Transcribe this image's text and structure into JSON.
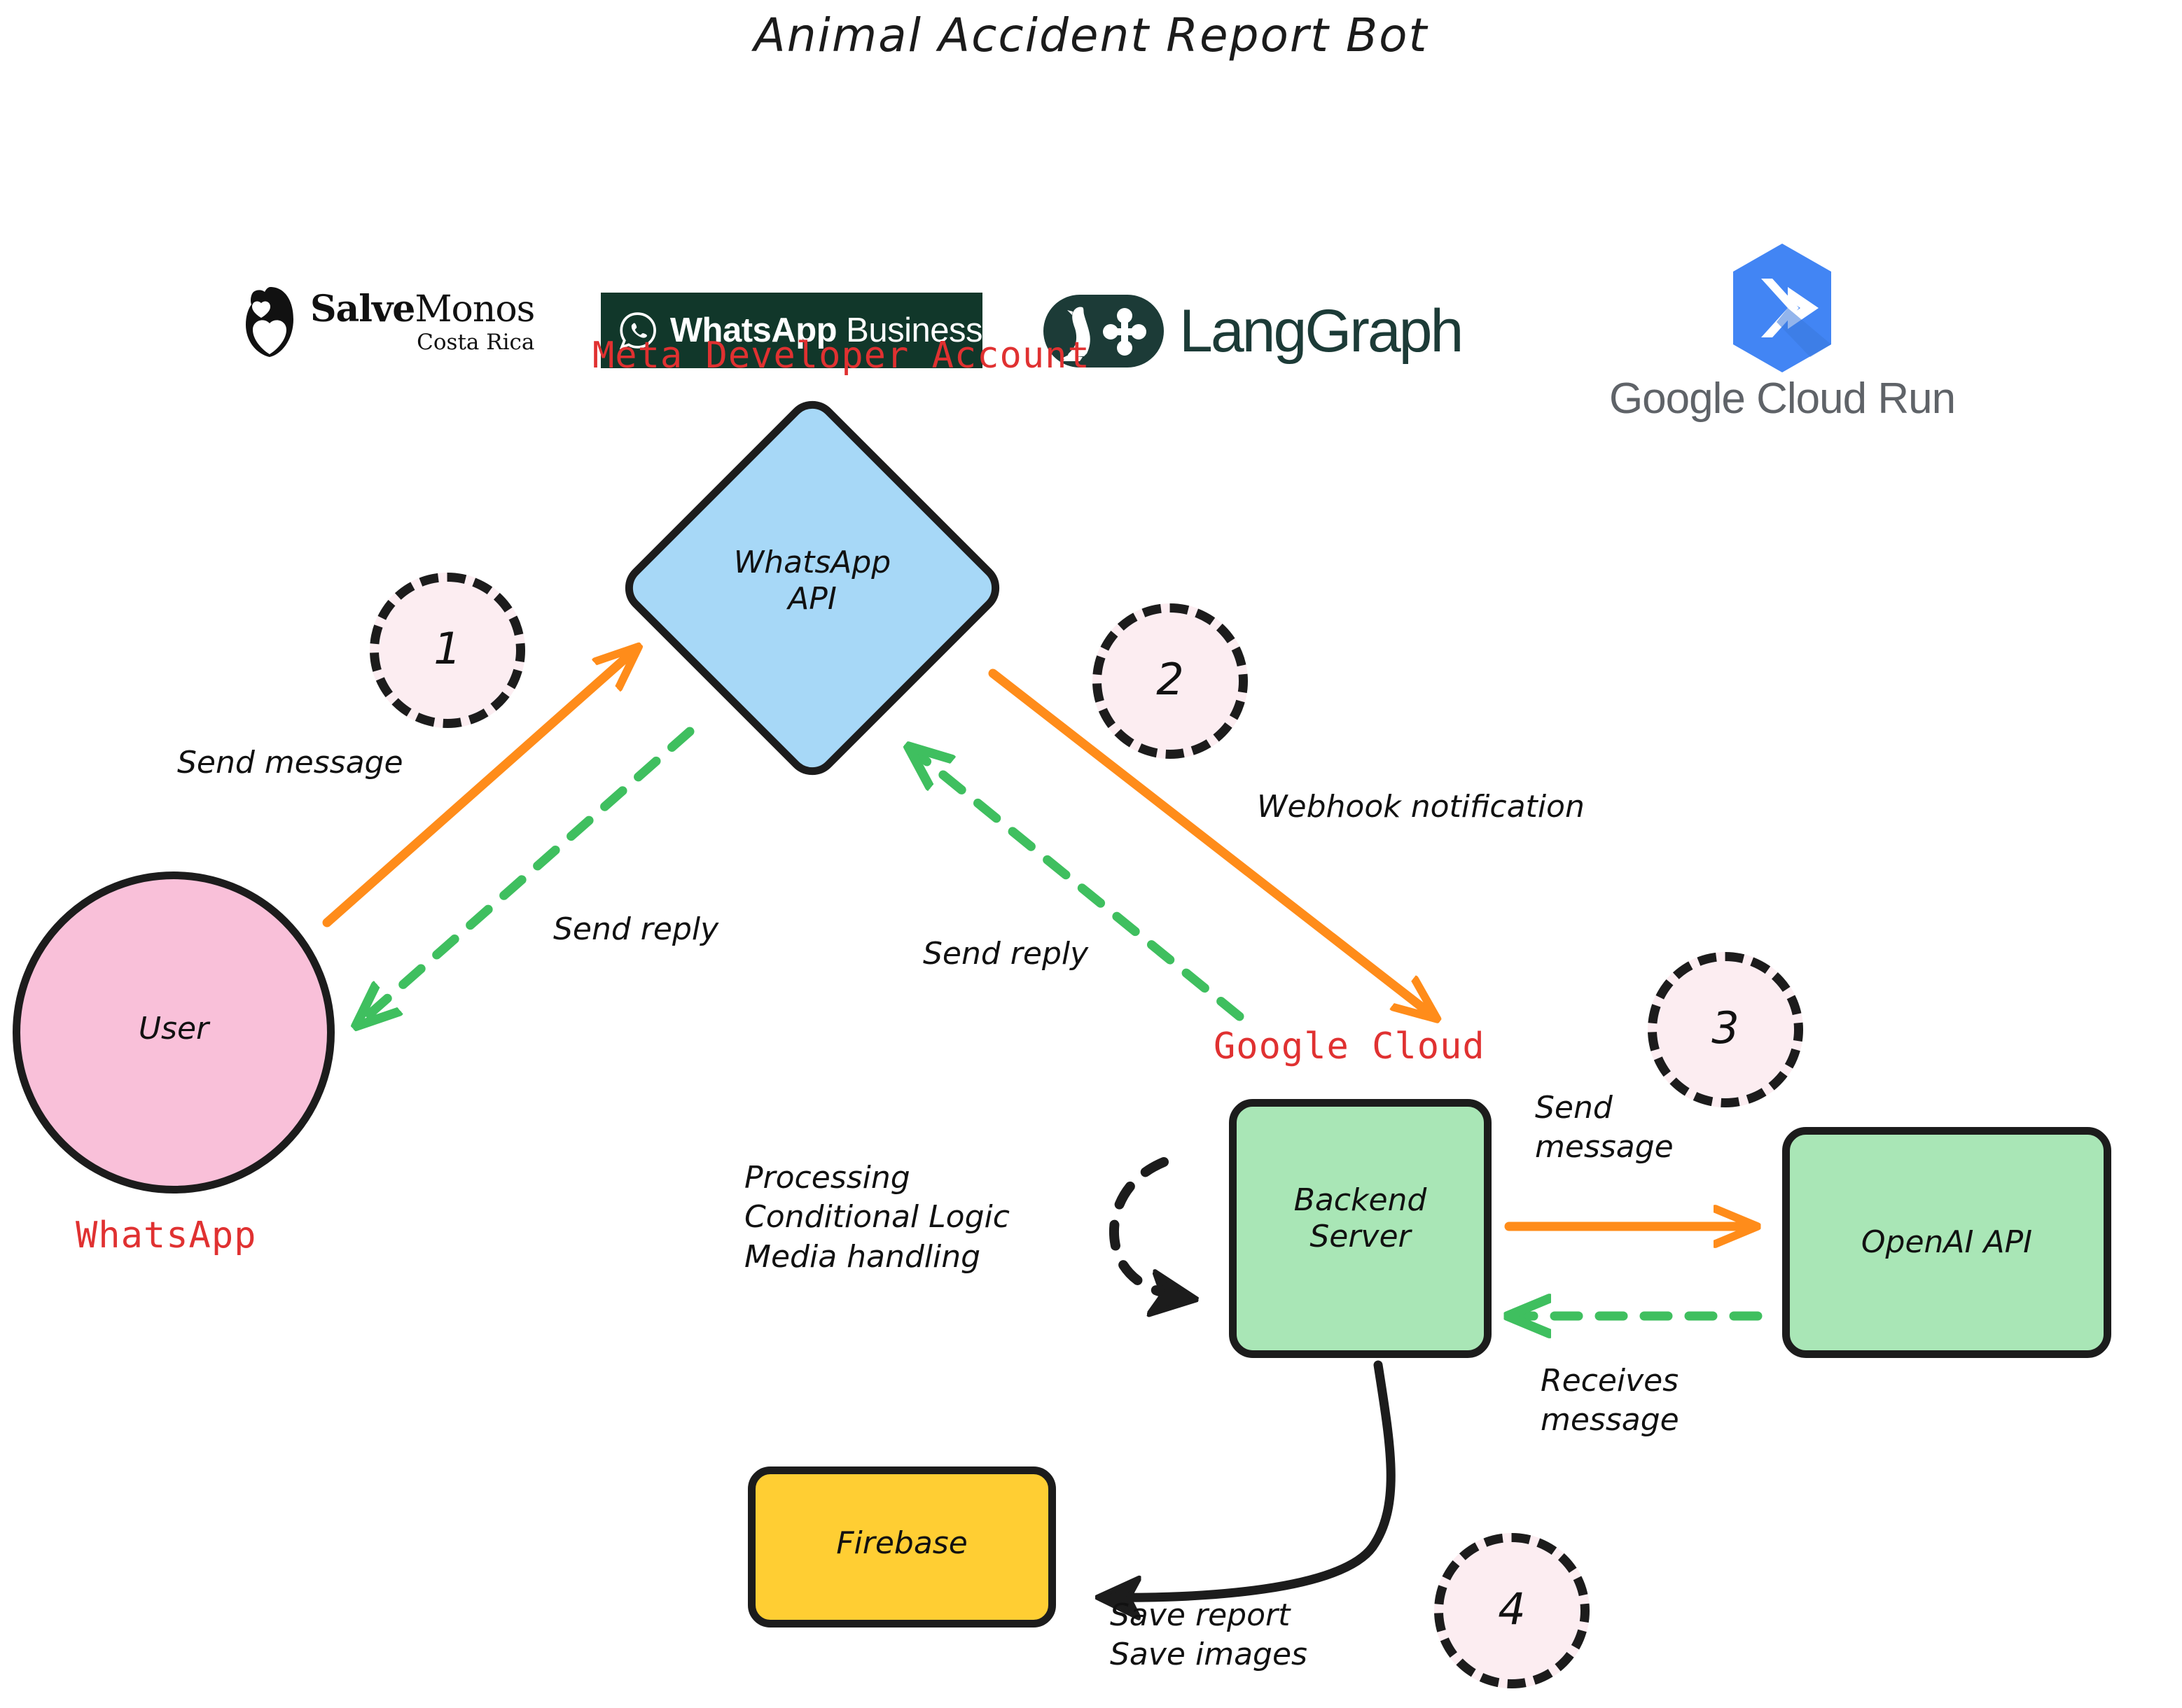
{
  "title": "Animal Accident Report Bot",
  "logos": [
    {
      "name": "salvemonos-logo",
      "primary": "Salve",
      "secondary": "Monos",
      "sub": "Costa Rica",
      "icon": "monkey-head-icon"
    },
    {
      "name": "whatsapp-business-logo",
      "primary": "WhatsApp",
      "secondary": " Business",
      "icon": "whatsapp-phone-icon",
      "bg": "#11372A"
    },
    {
      "name": "langgraph-logo",
      "primary": "LangGraph",
      "icon": "parrot-graph-icon",
      "bg": "#1C3B37"
    },
    {
      "name": "google-cloud-run-logo",
      "primary": "Google",
      "secondary": " Cloud Run",
      "icon": "cloud-run-hexagon-icon",
      "bg": "#4285F4"
    }
  ],
  "group_labels": {
    "meta": "Meta Developer Account",
    "whatsapp": "WhatsApp",
    "google_cloud": "Google Cloud"
  },
  "nodes": {
    "whatsapp_api": {
      "line1": "WhatsApp",
      "line2": "API",
      "color": "#A7D8F7",
      "shape": "diamond"
    },
    "user": {
      "line1": "User",
      "color": "#F9C0D9",
      "shape": "circle"
    },
    "backend": {
      "line1": "Backend",
      "line2": "Server",
      "color": "#A9E6B6",
      "shape": "rounded-rect"
    },
    "openai": {
      "line1": "OpenAI API",
      "color": "#A9E6B6",
      "shape": "rounded-rect"
    },
    "firebase": {
      "line1": "Firebase",
      "color": "#FFCE33",
      "shape": "rounded-rect"
    }
  },
  "steps": [
    {
      "number": "1"
    },
    {
      "number": "2"
    },
    {
      "number": "3"
    },
    {
      "number": "4"
    }
  ],
  "edges": {
    "send_message_user": "Send message",
    "send_reply_user": "Send reply",
    "send_reply_backend": "Send reply",
    "webhook": "Webhook notification",
    "processing": "Processing\nConditional Logic\nMedia handling",
    "send_message_openai": "Send\nmessage",
    "receives_message": "Receives\nmessage",
    "save": "Save report\nSave images"
  },
  "colors": {
    "orange": "#FF8C1A",
    "green": "#3FBF5F",
    "black": "#1c1c1c",
    "red": "#E03131"
  }
}
